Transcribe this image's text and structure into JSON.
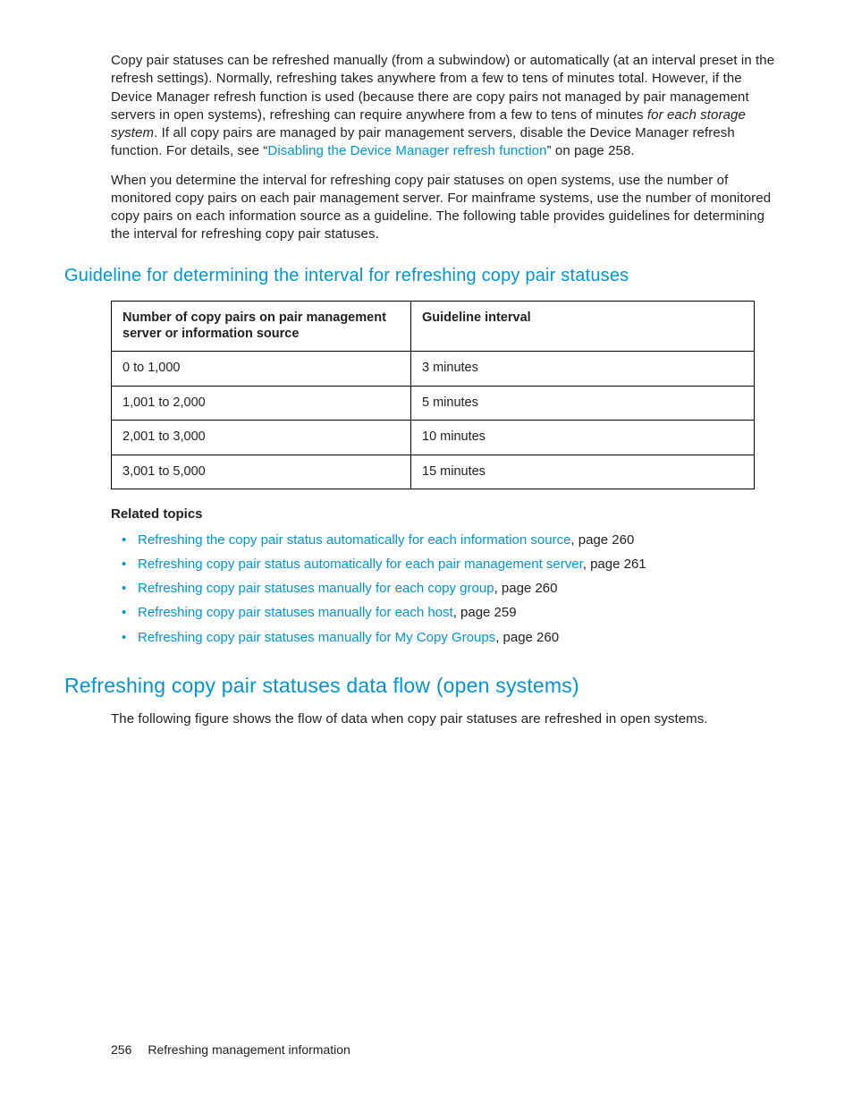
{
  "para1": {
    "t1": "Copy pair statuses can be refreshed manually (from a subwindow) or automatically (at an interval preset in the refresh settings). Normally, refreshing takes anywhere from a few to tens of minutes total. However, if the Device Manager refresh function is used (because there are copy pairs not managed by pair management servers in open systems), refreshing can require anywhere from a few to tens of minutes ",
    "italic": "for each storage system",
    "t2": ". If all copy pairs are managed by pair management servers, disable the Device Manager refresh function. For details, see “",
    "link": "Disabling the Device Manager refresh function",
    "t3": "” on page 258."
  },
  "para2": "When you determine the interval for refreshing copy pair statuses on open systems, use the number of monitored copy pairs on each pair management server. For mainframe systems, use the number of monitored copy pairs on each information source as a guideline. The following table provides guidelines for determining the interval for refreshing copy pair statuses.",
  "section1": "Guideline for determining the interval for refreshing copy pair statuses",
  "table": {
    "h1": "Number of copy pairs on pair management server or information source",
    "h2": "Guideline interval",
    "rows": [
      {
        "c1": "0 to 1,000",
        "c2": "3 minutes"
      },
      {
        "c1": "1,001 to 2,000",
        "c2": "5 minutes"
      },
      {
        "c1": "2,001 to 3,000",
        "c2": "10 minutes"
      },
      {
        "c1": "3,001 to 5,000",
        "c2": "15 minutes"
      }
    ]
  },
  "related_heading": "Related topics",
  "related": [
    {
      "link": "Refreshing the copy pair status automatically for each information source",
      "tail": ", page 260"
    },
    {
      "link": "Refreshing copy pair status automatically for each pair management server",
      "tail": ", page 261"
    },
    {
      "link": "Refreshing copy pair statuses manually for each copy group",
      "tail": ", page 260"
    },
    {
      "link": "Refreshing copy pair statuses manually for each host",
      "tail": ", page 259"
    },
    {
      "link": "Refreshing copy pair statuses manually for My Copy Groups",
      "tail": ", page 260"
    }
  ],
  "section2": "Refreshing copy pair statuses data flow (open systems)",
  "para3": "The following figure shows the flow of data when copy pair statuses are refreshed in open systems.",
  "footer": {
    "page": "256",
    "title": "Refreshing management information"
  }
}
